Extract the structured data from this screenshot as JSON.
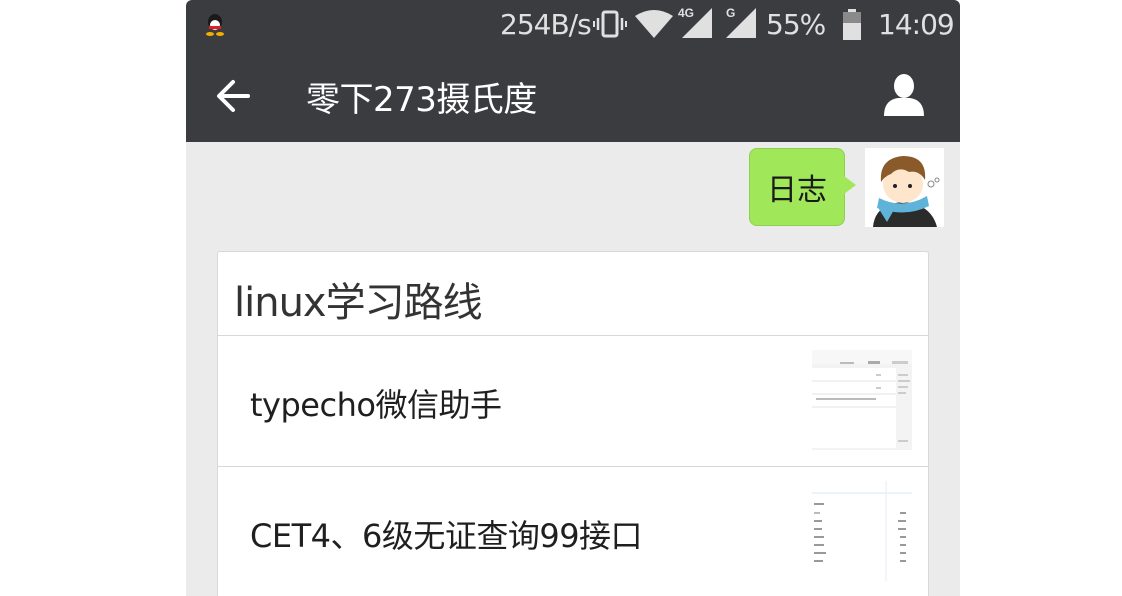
{
  "status_bar": {
    "net_speed": "254B/s",
    "network_type": "4G",
    "signal_badge": "G",
    "battery": "55%",
    "time": "14:09",
    "icons": [
      "qq-icon",
      "vibrate-icon",
      "wifi-icon",
      "signal-icon",
      "signal-icon",
      "battery-icon"
    ]
  },
  "title_bar": {
    "title": "零下273摄氏度",
    "back_icon": "arrow-left-icon",
    "profile_icon": "person-icon"
  },
  "chat": {
    "sent_message": "日志"
  },
  "card": {
    "title": "linux学习路线",
    "articles": [
      {
        "title": "typecho微信助手"
      },
      {
        "title": "CET4、6级无证查询99接口"
      }
    ]
  },
  "colors": {
    "bar_bg": "#3b3c40",
    "chat_bg": "#ebebeb",
    "bubble": "#a0e75a"
  }
}
